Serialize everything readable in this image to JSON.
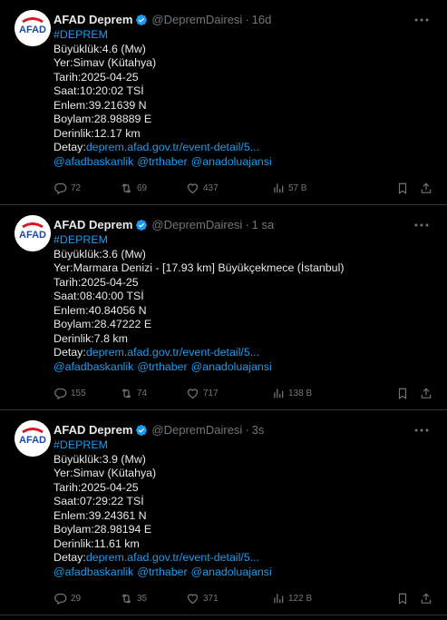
{
  "tweets": [
    {
      "name": "AFAD Deprem",
      "handle": "@DepremDairesi",
      "time": "16d",
      "hashtag": "#DEPREM",
      "lines": [
        "Büyüklük:4.6 (Mw)",
        "Yer:Simav (Kütahya)",
        "Tarih:2025-04-25",
        "Saat:10:20:02 TSİ",
        "Enlem:39.21639 N",
        "Boylam:28.98889 E",
        "Derinlik:12.17 km"
      ],
      "detay_label": "Detay:",
      "detay_link": "deprem.afad.gov.tr/event-detail/5...",
      "mentions": [
        "@afadbaskanlik",
        "@trthaber",
        "@anadoluajansi"
      ],
      "replies": "72",
      "retweets": "69",
      "likes": "437",
      "views": "57 B"
    },
    {
      "name": "AFAD Deprem",
      "handle": "@DepremDairesi",
      "time": "1 sa",
      "hashtag": "#DEPREM",
      "lines": [
        "Büyüklük:3.6 (Mw)",
        "Yer:Marmara Denizi - [17.93 km] Büyükçekmece (İstanbul)",
        "Tarih:2025-04-25",
        "Saat:08:40:00 TSİ",
        "Enlem:40.84056 N",
        "Boylam:28.47222 E",
        "Derinlik:7.8 km"
      ],
      "detay_label": "Detay:",
      "detay_link": "deprem.afad.gov.tr/event-detail/5...",
      "mentions": [
        "@afadbaskanlik",
        "@trthaber",
        "@anadoluajansi"
      ],
      "replies": "155",
      "retweets": "74",
      "likes": "717",
      "views": "138 B"
    },
    {
      "name": "AFAD Deprem",
      "handle": "@DepremDairesi",
      "time": "3s",
      "hashtag": "#DEPREM",
      "lines": [
        "Büyüklük:3.9 (Mw)",
        "Yer:Simav (Kütahya)",
        "Tarih:2025-04-25",
        "Saat:07:29:22 TSİ",
        "Enlem:39.24361 N",
        "Boylam:28.98194 E",
        "Derinlik:11.61 km"
      ],
      "detay_label": "Detay:",
      "detay_link": "deprem.afad.gov.tr/event-detail/5...",
      "mentions": [
        "@afadbaskanlik",
        "@trthaber",
        "@anadoluajansi"
      ],
      "replies": "29",
      "retweets": "35",
      "likes": "371",
      "views": "122 B"
    }
  ],
  "avatar_text": "AFAD",
  "colors": {
    "background": "#000000",
    "link": "#1d9bf0",
    "muted": "#71767b",
    "verified": "#1d9bf0",
    "afad_red": "#d71a28",
    "afad_blue": "#1c4a9e"
  },
  "icons": [
    "verified-badge-icon",
    "more-icon",
    "reply-icon",
    "retweet-icon",
    "like-icon",
    "views-icon",
    "bookmark-icon",
    "share-icon"
  ]
}
